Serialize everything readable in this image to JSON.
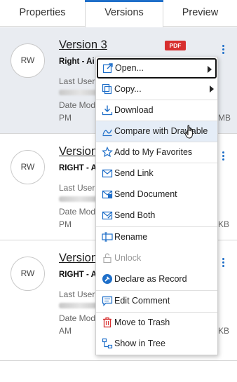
{
  "tabs": [
    {
      "label": "Properties"
    },
    {
      "label": "Versions"
    },
    {
      "label": "Preview"
    }
  ],
  "versions": [
    {
      "initials": "RW",
      "title": "Version 3",
      "subtitle": "Right - Ai",
      "last_user_label": "Last User",
      "date_label": "Date Mod",
      "time_suffix": "PM",
      "size_suffix": "MB",
      "badge": "PDF"
    },
    {
      "initials": "RW",
      "title": "Version",
      "subtitle": "RIGHT - A",
      "last_user_label": "Last User",
      "date_label": "Date Mod",
      "time_suffix": "PM",
      "size_suffix": "KB"
    },
    {
      "initials": "RW",
      "title": "Version",
      "subtitle": "RIGHT - A",
      "last_user_label": "Last User",
      "date_label": "Date Mod",
      "time_suffix": "AM",
      "size_suffix": "KB"
    }
  ],
  "menu": {
    "items": [
      {
        "label": "Open...",
        "icon": "open-external-icon"
      },
      {
        "label": "Copy...",
        "icon": "copy-icon"
      },
      {
        "label": "Download",
        "icon": "download-icon"
      },
      {
        "label": "Compare with Drawable",
        "icon": "compare-icon"
      },
      {
        "label": "Add to My Favorites",
        "icon": "star-icon"
      },
      {
        "label": "Send Link",
        "icon": "envelope-link-icon"
      },
      {
        "label": "Send Document",
        "icon": "envelope-document-icon"
      },
      {
        "label": "Send Both",
        "icon": "envelope-both-icon"
      },
      {
        "label": "Rename",
        "icon": "rename-icon"
      },
      {
        "label": "Unlock",
        "icon": "unlock-icon"
      },
      {
        "label": "Declare as Record",
        "icon": "gavel-icon"
      },
      {
        "label": "Edit Comment",
        "icon": "comment-icon"
      },
      {
        "label": "Move to Trash",
        "icon": "trash-icon"
      },
      {
        "label": "Show in Tree",
        "icon": "tree-icon"
      }
    ]
  },
  "colors": {
    "accent": "#1f6fc9",
    "pdf_badge": "#d72f2f",
    "selected_row": "#e9ecf1"
  }
}
